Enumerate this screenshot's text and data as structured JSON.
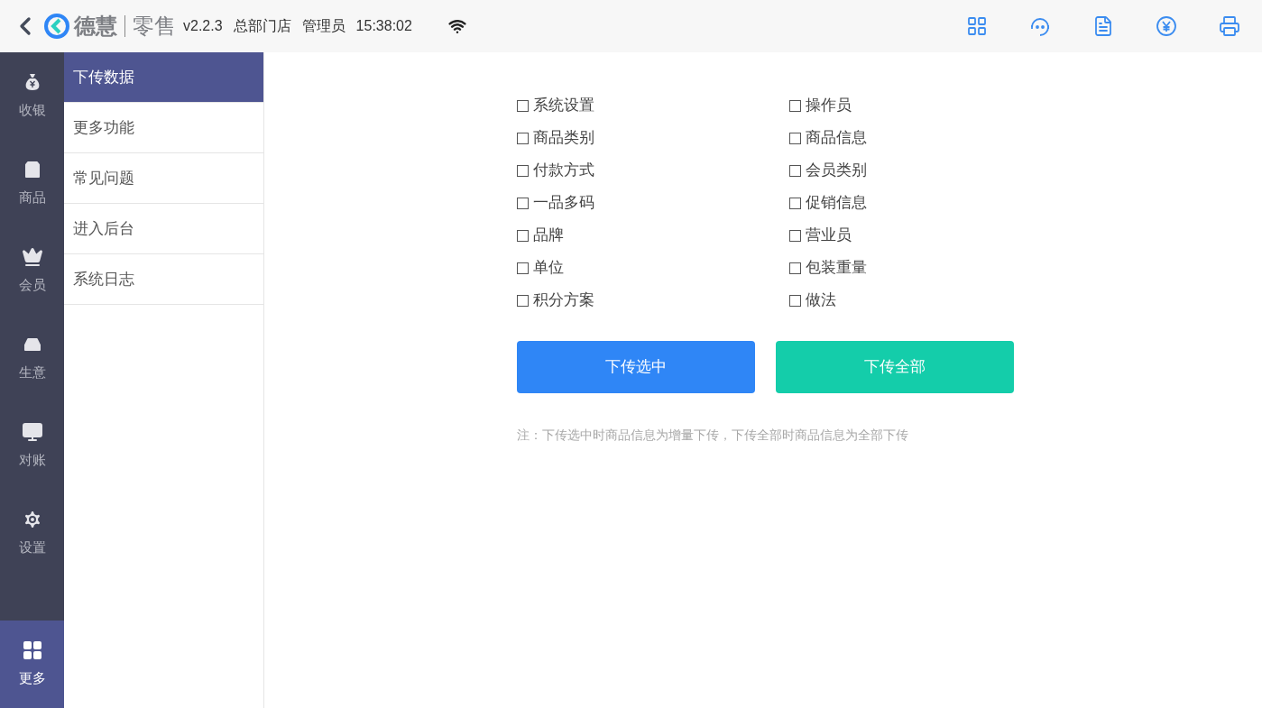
{
  "header": {
    "brand": "德慧",
    "product": "零售",
    "version": "v2.2.3",
    "store": "总部门店",
    "role": "管理员",
    "time": "15:38:02"
  },
  "rail": [
    {
      "kind": "cashier",
      "label": "收银",
      "selected": false
    },
    {
      "kind": "goods",
      "label": "商品",
      "selected": false
    },
    {
      "kind": "member",
      "label": "会员",
      "selected": false
    },
    {
      "kind": "business",
      "label": "生意",
      "selected": false
    },
    {
      "kind": "reconcile",
      "label": "对账",
      "selected": false
    },
    {
      "kind": "settings",
      "label": "设置",
      "selected": false
    },
    {
      "kind": "more",
      "label": "更多",
      "selected": true
    }
  ],
  "submenu": [
    {
      "label": "下传数据",
      "selected": true
    },
    {
      "label": "更多功能",
      "selected": false
    },
    {
      "label": "常见问题",
      "selected": false
    },
    {
      "label": "进入后台",
      "selected": false
    },
    {
      "label": "系统日志",
      "selected": false
    }
  ],
  "options": [
    {
      "label": "系统设置",
      "checked": false
    },
    {
      "label": "操作员",
      "checked": false
    },
    {
      "label": "商品类别",
      "checked": false
    },
    {
      "label": "商品信息",
      "checked": false
    },
    {
      "label": "付款方式",
      "checked": false
    },
    {
      "label": "会员类别",
      "checked": false
    },
    {
      "label": "一品多码",
      "checked": false
    },
    {
      "label": "促销信息",
      "checked": false
    },
    {
      "label": "品牌",
      "checked": false
    },
    {
      "label": "营业员",
      "checked": false
    },
    {
      "label": "单位",
      "checked": false
    },
    {
      "label": "包装重量",
      "checked": false
    },
    {
      "label": "积分方案",
      "checked": false
    },
    {
      "label": "做法",
      "checked": false
    }
  ],
  "buttons": [
    {
      "kind": "selected",
      "label": "下传选中"
    },
    {
      "kind": "all",
      "label": "下传全部"
    }
  ],
  "note": "注：下传选中时商品信息为增量下传，下传全部时商品信息为全部下传"
}
